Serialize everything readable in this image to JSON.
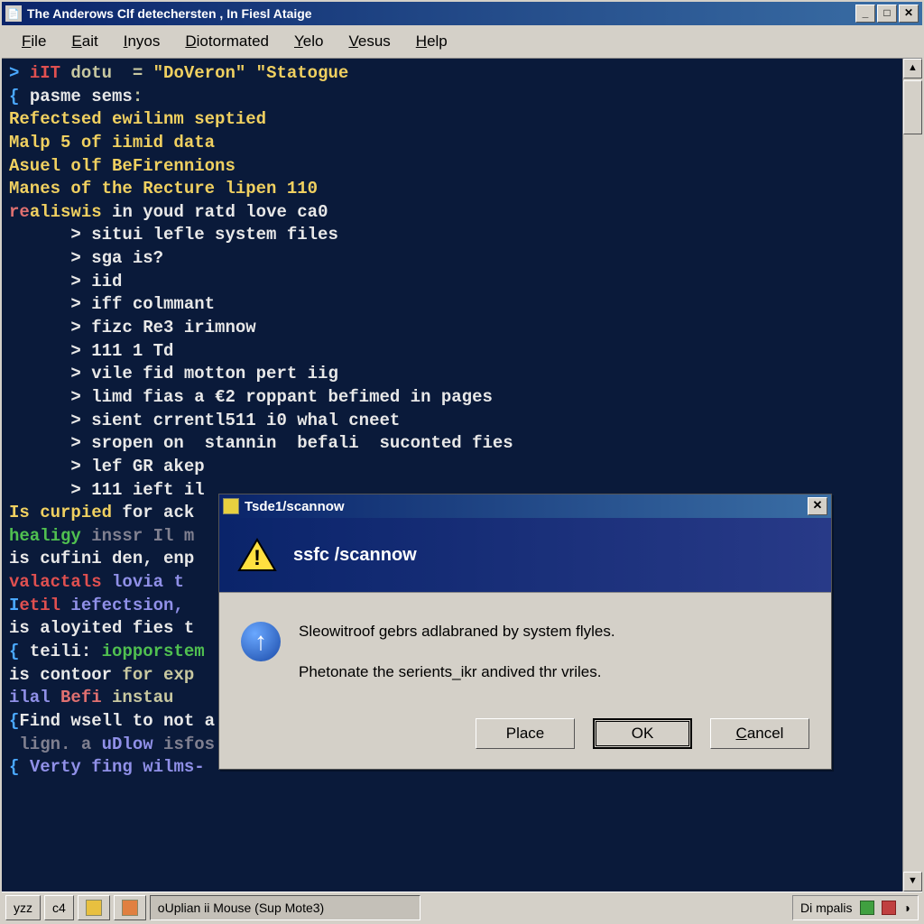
{
  "window": {
    "title": "The Anderows Clf detechersten , In Fiesl Ataige",
    "menus": [
      "File",
      "Eait",
      "Inyos",
      "Diotormated",
      "Yelo",
      "Vesus",
      "Help"
    ]
  },
  "terminal": {
    "lines": [
      {
        "segs": [
          {
            "c": "c-prompt",
            "t": ">"
          },
          {
            "c": "",
            "t": " "
          },
          {
            "c": "c-red",
            "t": "iIT"
          },
          {
            "c": "",
            "t": " dotu  = "
          },
          {
            "c": "c-str",
            "t": "\"DoVeron\" \"Statogue"
          }
        ]
      },
      {
        "segs": [
          {
            "c": "",
            "t": ""
          }
        ]
      },
      {
        "segs": [
          {
            "c": "c-prompt",
            "t": "{ "
          },
          {
            "c": "c-white",
            "t": "pasme sems"
          },
          {
            "c": "",
            "t": ":"
          }
        ]
      },
      {
        "segs": [
          {
            "c": "c-yellow",
            "t": "Refectsed ewilinm septied"
          }
        ]
      },
      {
        "segs": [
          {
            "c": "c-yellow",
            "t": "Malp 5 of iimid data"
          }
        ]
      },
      {
        "segs": [
          {
            "c": "c-yellow",
            "t": "Asuel olf BeFirennions"
          }
        ]
      },
      {
        "segs": [
          {
            "c": "c-yellow",
            "t": "Manes of the Recture lipen 110"
          }
        ]
      },
      {
        "segs": [
          {
            "c": "",
            "t": ""
          }
        ]
      },
      {
        "segs": [
          {
            "c": "c-hot",
            "t": "re"
          },
          {
            "c": "c-yellow",
            "t": "aliswis"
          },
          {
            "c": "c-white",
            "t": " in youd ratd love ca0"
          }
        ]
      },
      {
        "segs": [
          {
            "c": "c-white",
            "t": "      > situi lefle system files"
          }
        ]
      },
      {
        "segs": [
          {
            "c": "c-white",
            "t": "      > sga is?"
          }
        ]
      },
      {
        "segs": [
          {
            "c": "c-white",
            "t": "      > iid"
          }
        ]
      },
      {
        "segs": [
          {
            "c": "c-white",
            "t": "      > iff colmmant"
          }
        ]
      },
      {
        "segs": [
          {
            "c": "c-white",
            "t": "      > fizc Re3 irimnow"
          }
        ]
      },
      {
        "segs": [
          {
            "c": "c-white",
            "t": "      > 111 1 Td"
          }
        ]
      },
      {
        "segs": [
          {
            "c": "c-white",
            "t": "      > vile fid motton pert iig"
          }
        ]
      },
      {
        "segs": [
          {
            "c": "c-white",
            "t": "      > limd fias a €2 roppant befimed in pages"
          }
        ]
      },
      {
        "segs": [
          {
            "c": "c-white",
            "t": "      > sient crrentl511 i0 whal cneet"
          }
        ]
      },
      {
        "segs": [
          {
            "c": "c-white",
            "t": "      > sropen on  stannin  befali  suconted fies"
          }
        ]
      },
      {
        "segs": [
          {
            "c": "c-white",
            "t": "      > lef GR akep"
          }
        ]
      },
      {
        "segs": [
          {
            "c": "c-white",
            "t": "      > 111 ieft il"
          }
        ]
      },
      {
        "segs": [
          {
            "c": "c-yellow",
            "t": "Is curpied"
          },
          {
            "c": "c-white",
            "t": " for ack"
          }
        ]
      },
      {
        "segs": [
          {
            "c": "c-green",
            "t": "healigy"
          },
          {
            "c": "c-dim",
            "t": " inssr Il m"
          }
        ]
      },
      {
        "segs": [
          {
            "c": "c-white",
            "t": "is cufini den, enp"
          }
        ]
      },
      {
        "segs": [
          {
            "c": "",
            "t": ""
          }
        ]
      },
      {
        "segs": [
          {
            "c": "c-red",
            "t": "valactals"
          },
          {
            "c": "c-cyan",
            "t": " lovia t"
          }
        ]
      },
      {
        "segs": [
          {
            "c": "c-prompt",
            "t": "I"
          },
          {
            "c": "c-red",
            "t": "etil"
          },
          {
            "c": "c-cyan",
            "t": " iefectsion,"
          }
        ]
      },
      {
        "segs": [
          {
            "c": "c-white",
            "t": "is aloyited fies t"
          }
        ]
      },
      {
        "segs": [
          {
            "c": "c-prompt",
            "t": "{ "
          },
          {
            "c": "c-white",
            "t": "teili: "
          },
          {
            "c": "c-green",
            "t": "iopporstem"
          }
        ]
      },
      {
        "segs": [
          {
            "c": "c-white",
            "t": "is contoor"
          },
          {
            "c": "",
            "t": " for exp"
          }
        ]
      },
      {
        "segs": [
          {
            "c": "c-cyan",
            "t": "ilal "
          },
          {
            "c": "c-hot",
            "t": "Befi"
          },
          {
            "c": "",
            "t": " instau"
          }
        ]
      },
      {
        "segs": [
          {
            "c": "",
            "t": ""
          }
        ]
      },
      {
        "segs": [
          {
            "c": "c-prompt",
            "t": "{"
          },
          {
            "c": "c-white",
            "t": "Find wsell to not a"
          }
        ]
      },
      {
        "segs": [
          {
            "c": "c-dim",
            "t": " lign. a "
          },
          {
            "c": "c-cyan",
            "t": "uDlow"
          },
          {
            "c": "c-dim",
            "t": " isfos"
          }
        ]
      },
      {
        "segs": [
          {
            "c": "c-prompt",
            "t": "{ "
          },
          {
            "c": "c-cyan",
            "t": "Verty fing wilms-"
          }
        ]
      }
    ]
  },
  "dialog": {
    "title": "Tsde1/scannow",
    "header": "ssfc /scannow",
    "body1": "Sleowitroof gebrs adlabraned by system flyles.",
    "body2": "Phetonate the serients_ikr andived thr vriles.",
    "btn_place": "Place",
    "btn_ok": "OK",
    "btn_cancel": "Cancel"
  },
  "taskbar": {
    "left1": "yzz",
    "left2": "c4",
    "task_label": "oUplian ii Mouse (Sup Mote3)",
    "tray_text": "Di mpalis"
  }
}
